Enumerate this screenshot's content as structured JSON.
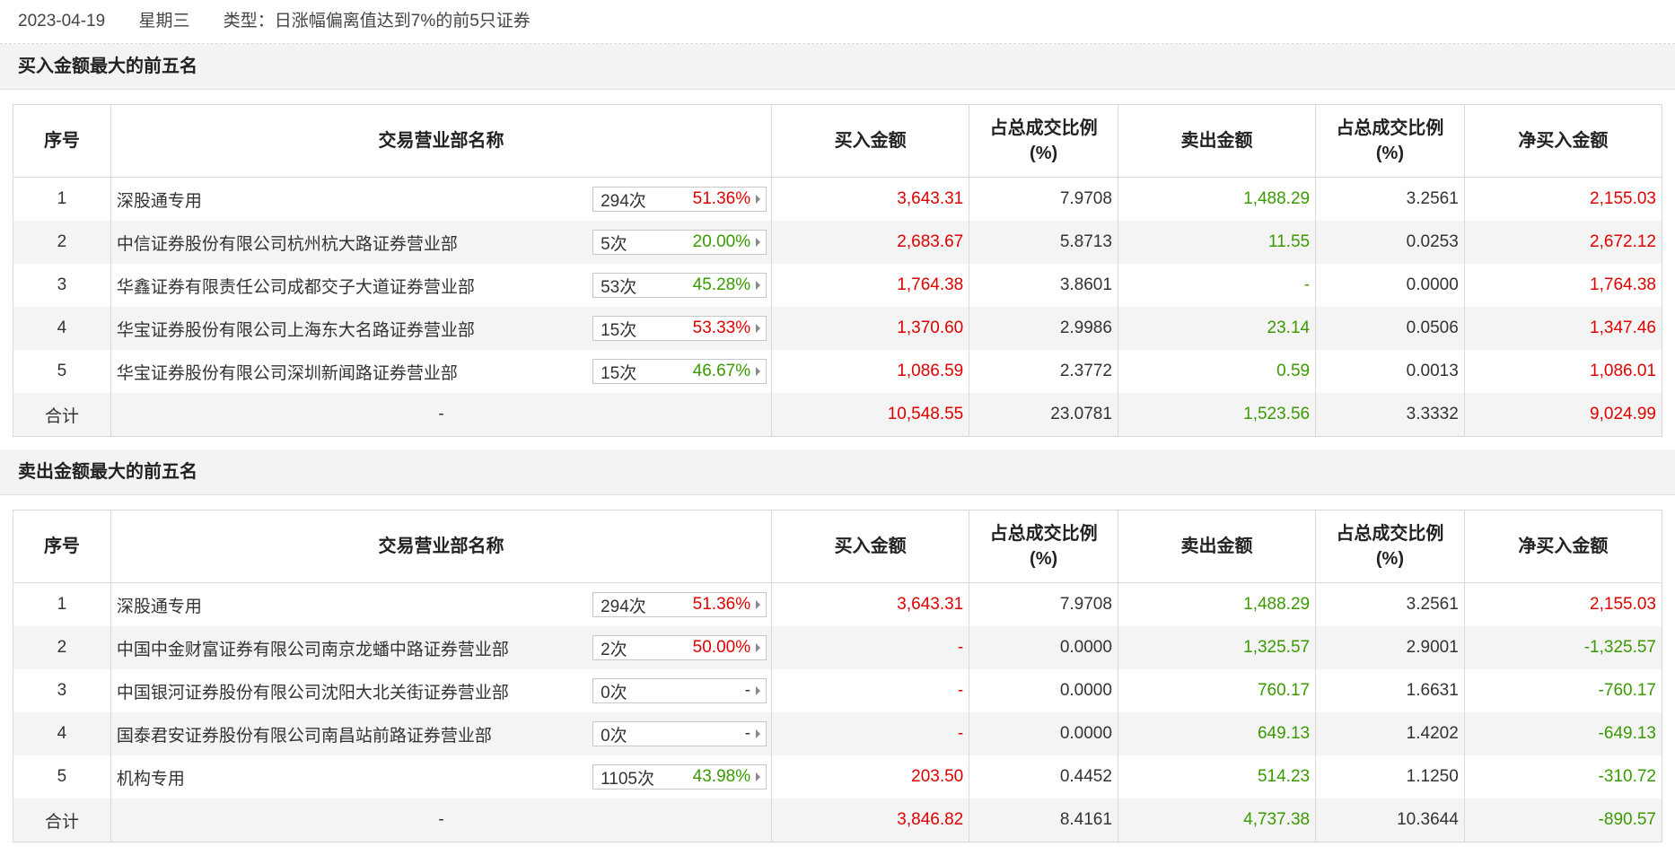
{
  "header": {
    "date": "2023-04-19",
    "weekday": "星期三",
    "type": "类型：日涨幅偏离值达到7%的前5只证券"
  },
  "colors": {
    "up": "#e00000",
    "down": "#3a9a00"
  },
  "columns": {
    "seq": "序号",
    "name": "交易营业部名称",
    "buy": "买入金额",
    "buy_ratio_l1": "占总成交比例",
    "buy_ratio_l2": "(%)",
    "sell": "卖出金额",
    "sell_ratio_l1": "占总成交比例",
    "sell_ratio_l2": "(%)",
    "net": "净买入金额"
  },
  "buy_section": {
    "title": "买入金额最大的前五名",
    "rows": [
      {
        "seq": "1",
        "name": "深股通专用",
        "count": "294次",
        "pct": "51.36%",
        "pct_color": "red",
        "buy": "3,643.31",
        "buy_ratio": "7.9708",
        "sell": "1,488.29",
        "sell_ratio": "3.2561",
        "net": "2,155.03",
        "net_color": "red"
      },
      {
        "seq": "2",
        "name": "中信证券股份有限公司杭州杭大路证券营业部",
        "count": "5次",
        "pct": "20.00%",
        "pct_color": "green",
        "buy": "2,683.67",
        "buy_ratio": "5.8713",
        "sell": "11.55",
        "sell_ratio": "0.0253",
        "net": "2,672.12",
        "net_color": "red"
      },
      {
        "seq": "3",
        "name": "华鑫证券有限责任公司成都交子大道证券营业部",
        "count": "53次",
        "pct": "45.28%",
        "pct_color": "green",
        "buy": "1,764.38",
        "buy_ratio": "3.8601",
        "sell": "-",
        "sell_ratio": "0.0000",
        "net": "1,764.38",
        "net_color": "red"
      },
      {
        "seq": "4",
        "name": "华宝证券股份有限公司上海东大名路证券营业部",
        "count": "15次",
        "pct": "53.33%",
        "pct_color": "red",
        "buy": "1,370.60",
        "buy_ratio": "2.9986",
        "sell": "23.14",
        "sell_ratio": "0.0506",
        "net": "1,347.46",
        "net_color": "red"
      },
      {
        "seq": "5",
        "name": "华宝证券股份有限公司深圳新闻路证券营业部",
        "count": "15次",
        "pct": "46.67%",
        "pct_color": "green",
        "buy": "1,086.59",
        "buy_ratio": "2.3772",
        "sell": "0.59",
        "sell_ratio": "0.0013",
        "net": "1,086.01",
        "net_color": "red"
      }
    ],
    "total": {
      "label": "合计",
      "name": "-",
      "buy": "10,548.55",
      "buy_ratio": "23.0781",
      "sell": "1,523.56",
      "sell_ratio": "3.3332",
      "net": "9,024.99",
      "net_color": "red"
    }
  },
  "sell_section": {
    "title": "卖出金额最大的前五名",
    "rows": [
      {
        "seq": "1",
        "name": "深股通专用",
        "count": "294次",
        "pct": "51.36%",
        "pct_color": "red",
        "buy": "3,643.31",
        "buy_ratio": "7.9708",
        "sell": "1,488.29",
        "sell_ratio": "3.2561",
        "net": "2,155.03",
        "net_color": "red"
      },
      {
        "seq": "2",
        "name": "中国中金财富证券有限公司南京龙蟠中路证券营业部",
        "count": "2次",
        "pct": "50.00%",
        "pct_color": "red",
        "buy": "-",
        "buy_ratio": "0.0000",
        "sell": "1,325.57",
        "sell_ratio": "2.9001",
        "net": "-1,325.57",
        "net_color": "green"
      },
      {
        "seq": "3",
        "name": "中国银河证券股份有限公司沈阳大北关街证券营业部",
        "count": "0次",
        "pct": "-",
        "pct_color": "dark",
        "buy": "-",
        "buy_ratio": "0.0000",
        "sell": "760.17",
        "sell_ratio": "1.6631",
        "net": "-760.17",
        "net_color": "green"
      },
      {
        "seq": "4",
        "name": "国泰君安证券股份有限公司南昌站前路证券营业部",
        "count": "0次",
        "pct": "-",
        "pct_color": "dark",
        "buy": "-",
        "buy_ratio": "0.0000",
        "sell": "649.13",
        "sell_ratio": "1.4202",
        "net": "-649.13",
        "net_color": "green"
      },
      {
        "seq": "5",
        "name": "机构专用",
        "count": "1105次",
        "pct": "43.98%",
        "pct_color": "green",
        "buy": "203.50",
        "buy_ratio": "0.4452",
        "sell": "514.23",
        "sell_ratio": "1.1250",
        "net": "-310.72",
        "net_color": "green"
      }
    ],
    "total": {
      "label": "合计",
      "name": "-",
      "buy": "3,846.82",
      "buy_ratio": "8.4161",
      "sell": "4,737.38",
      "sell_ratio": "10.3644",
      "net": "-890.57",
      "net_color": "green"
    }
  }
}
